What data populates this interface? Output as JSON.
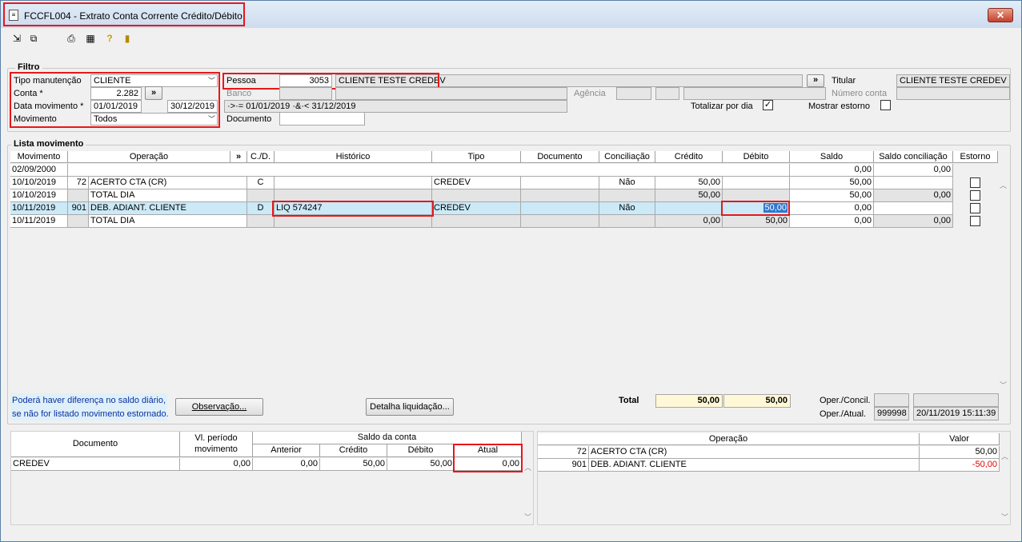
{
  "window": {
    "title": "FCCFL004 - Extrato Conta Corrente Crédito/Débito",
    "close_label": "✕"
  },
  "toolbar": {
    "icons": [
      "export-icon",
      "copy-icon",
      "printer-icon",
      "calculator-icon",
      "help-icon",
      "exit-door-icon"
    ]
  },
  "filtro": {
    "title": "Filtro",
    "tipo_manutencao_label": "Tipo manutenção",
    "tipo_manutencao_value": "CLIENTE",
    "conta_label": "Conta *",
    "conta_value": "2.282",
    "conta_button": "»",
    "data_movimento_label": "Data movimento *",
    "data_de": "01/01/2019",
    "data_ate": "30/12/2019",
    "movimento_label": "Movimento",
    "movimento_value": "Todos",
    "pessoa_label": "Pessoa",
    "pessoa_code": "3053",
    "pessoa_name": "CLIENTE TESTE CREDEV",
    "pessoa_button": "»",
    "titular_label": "Titular",
    "titular_value": "CLIENTE TESTE CREDEV",
    "banco_label": "Banco",
    "agencia_label": "Agência",
    "numero_conta_label": "Número conta",
    "date_expr": "·>·= 01/01/2019 ·&·< 31/12/2019",
    "totalizar_label": "Totalizar por dia",
    "totalizar_checked": "✓",
    "mostrar_estorno_label": "Mostrar estorno",
    "documento_label": "Documento"
  },
  "lista": {
    "title": "Lista movimento",
    "headers": [
      "Movimento",
      "Operação",
      "»",
      "C./D.",
      "Histórico",
      "Tipo",
      "Documento",
      "Conciliação",
      "Crédito",
      "Débito",
      "Saldo",
      "Saldo conciliação",
      "Estorno"
    ],
    "rows": [
      {
        "movimento": "02/09/2000",
        "op_code": "",
        "operacao": "",
        "cd": "",
        "historico": "",
        "tipo": "",
        "documento": "",
        "conciliacao": "",
        "credito": "",
        "debito": "",
        "saldo": "0,00",
        "saldo_conc": "0,00"
      },
      {
        "movimento": "10/10/2019",
        "op_code": "72",
        "operacao": "ACERTO CTA (CR)",
        "cd": "C",
        "historico": "",
        "tipo": "CREDEV",
        "documento": "",
        "conciliacao": "Não",
        "credito": "50,00",
        "debito": "",
        "saldo": "50,00",
        "saldo_conc": ""
      },
      {
        "movimento": "10/10/2019",
        "op_code": "",
        "operacao": "TOTAL DIA",
        "cd": "",
        "historico": "",
        "tipo": "",
        "documento": "",
        "conciliacao": "",
        "credito": "50,00",
        "debito": "",
        "saldo": "50,00",
        "saldo_conc": "0,00"
      },
      {
        "movimento": "10/11/2019",
        "op_code": "901",
        "operacao": "DEB. ADIANT. CLIENTE",
        "cd": "D",
        "historico": "LIQ  574247",
        "tipo": "CREDEV",
        "documento": "",
        "conciliacao": "Não",
        "credito": "",
        "debito": "50,00",
        "saldo": "0,00",
        "saldo_conc": ""
      },
      {
        "movimento": "10/11/2019",
        "op_code": "",
        "operacao": "TOTAL DIA",
        "cd": "",
        "historico": "",
        "tipo": "",
        "documento": "",
        "conciliacao": "",
        "credito": "0,00",
        "debito": "50,00",
        "saldo": "0,00",
        "saldo_conc": "0,00"
      }
    ]
  },
  "footer": {
    "note_line1": "Poderá haver diferença no saldo diário,",
    "note_line2": "se não for listado movimento estornado.",
    "observacao_button": "Observação...",
    "detalha_button": "Detalha liquidação...",
    "total_label": "Total",
    "total_credito": "50,00",
    "total_debito": "50,00",
    "oper_concil_label": "Oper./Concil.",
    "oper_atual_label": "Oper./Atual.",
    "oper_atual_code": "999998",
    "oper_atual_date": "20/11/2019 15:11:39"
  },
  "saldo_grid": {
    "documento_header": "Documento",
    "vl_periodo_header": "Vl. período movimento",
    "saldo_conta_header": "Saldo da conta",
    "sub_headers": [
      "Anterior",
      "Crédito",
      "Débito",
      "Atual"
    ],
    "rows": [
      {
        "documento": "CREDEV",
        "vl_periodo": "0,00",
        "anterior": "0,00",
        "credito": "50,00",
        "debito": "50,00",
        "atual": "0,00"
      }
    ]
  },
  "operacao_grid": {
    "operacao_header": "Operação",
    "valor_header": "Valor",
    "rows": [
      {
        "code": "72",
        "name": "ACERTO CTA (CR)",
        "valor": "50,00"
      },
      {
        "code": "901",
        "name": "DEB. ADIANT. CLIENTE",
        "valor": "-50,00"
      }
    ]
  },
  "colors": {
    "selected_row": "#cbe9f7",
    "highlight_red": "#e8161b",
    "total_fill": "#fff8d6"
  }
}
